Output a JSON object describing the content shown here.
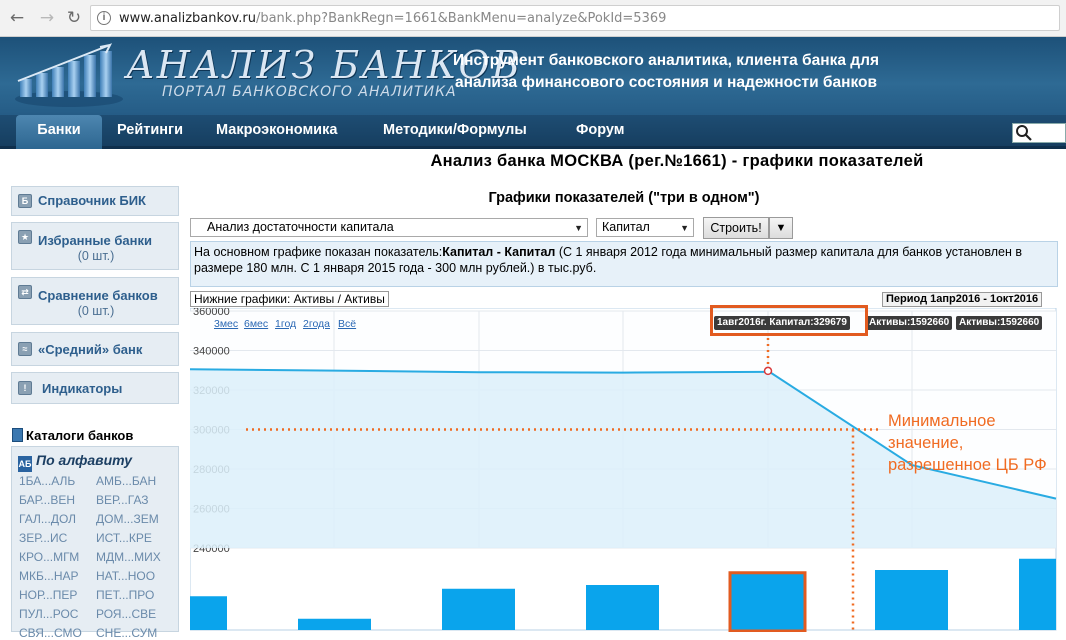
{
  "browser": {
    "url_host": "www.analizbankov.ru",
    "url_rest": "/bank.php?BankRegn=1661&BankMenu=analyze&PokId=5369",
    "icons": {
      "back": "arrow-left-icon",
      "forward": "arrow-right-icon",
      "reload": "reload-icon",
      "info": "info-icon"
    }
  },
  "header": {
    "logo_title": "АНАЛИЗ БАНКОВ",
    "logo_subtitle": "ПОРТАЛ БАНКОВСКОГО АНАЛИТИКА",
    "tagline": "Инструмент банковского аналитика, клиента банка для анализа финансового состояния и надежности банков"
  },
  "nav": {
    "items": [
      "Банки",
      "Рейтинги",
      "Макроэкономика",
      "Методики/Формулы",
      "Форум"
    ],
    "active": "Банки"
  },
  "page_title": "Анализ банка МОСКВА (рег.№1661) - графики показателей",
  "sidebar": {
    "boxes": [
      {
        "label": "Справочник БИК",
        "count": ""
      },
      {
        "label": "Избранные банки",
        "count": "(0 шт.)"
      },
      {
        "label": "Сравнение банков",
        "count": "(0 шт.)"
      },
      {
        "label": "«Средний» банк",
        "count": ""
      },
      {
        "label": "Индикаторы",
        "count": ""
      }
    ],
    "catalog_title": "Каталоги банков",
    "alpha_title": "По алфавиту",
    "alpha_links": [
      "1БА...АЛЬ",
      "АМБ...БАН",
      "БАР...ВЕН",
      "ВЕР...ГАЗ",
      "ГАЛ...ДОЛ",
      "ДОМ...ЗЕМ",
      "ЗЕР...ИС",
      "ИСТ...КРЕ",
      "КРО...МГМ",
      "МДМ...МИХ",
      "МКБ...НАР",
      "НАТ...НОО",
      "НОР...ПЕР",
      "ПЕТ...ПРО",
      "ПУЛ...РОС",
      "РОЯ...СВЕ",
      "СВЯ...СМО",
      "СНЕ...СУМ"
    ]
  },
  "main": {
    "heading": "Графики показателей (\"три в одном\")",
    "report_select": "Анализ достаточности капитала",
    "field_select": "Капитал",
    "build_button": "Строить!",
    "description_prefix": "На основном графике показан показатель:",
    "description_bold": "Капитал - Капитал",
    "description_rest": " (С 1 января 2012 года минимальный размер капитала для банков установлен в размере 180 млн. С 1 января 2015 года - 300 млн рублей.) в тыс.руб.",
    "lower_charts_label": "Нижние графики: Активы / Активы",
    "period_label": "Период 1апр2016 - 1окт2016",
    "zoom_links": [
      "3мес",
      "6мес",
      "1год",
      "2года",
      "Всё"
    ],
    "tooltip_main": "1авг2016г. Капитал:329679",
    "tooltip_extra": [
      "Активы:1592660",
      "Активы:1592660"
    ],
    "annotation": [
      "Минимальное",
      "значение,",
      "разрешенное ЦБ РФ"
    ]
  },
  "chart_data": {
    "type": "line",
    "y_ticks": [
      360000,
      340000,
      320000,
      300000,
      280000,
      260000,
      240000
    ],
    "ylim": [
      240000,
      360000
    ],
    "series": [
      {
        "values": [
          330500,
          329800,
          329000,
          328800,
          329200,
          329679,
          282000,
          265000
        ]
      }
    ],
    "threshold_line": 300000,
    "highlight_index": 5,
    "lower_bars": {
      "values": [
        0.45,
        0.15,
        0.55,
        0.6,
        0.75,
        0.8,
        0.95
      ],
      "highlight_index": 3
    },
    "colors": {
      "line": "#29abe2",
      "area": "#dcf0fa",
      "bars": "#0aa4ec",
      "highlight": "#e25b20",
      "dotted": "#f06b22"
    }
  }
}
